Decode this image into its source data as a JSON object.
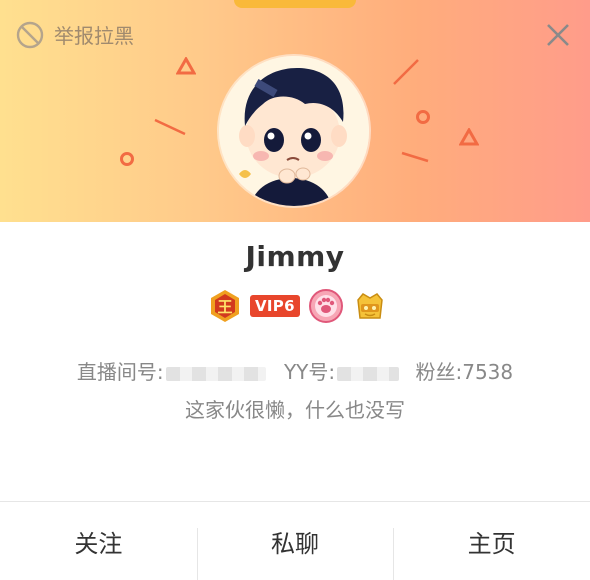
{
  "header": {
    "report_label": "举报拉黑",
    "colors": {
      "gradient_start": "#ffe08f",
      "gradient_end": "#ff9c8a",
      "decoration": "#f26b43"
    }
  },
  "profile": {
    "username": "Jimmy",
    "badges": [
      {
        "name": "king-badge",
        "text": "王"
      },
      {
        "name": "vip-badge",
        "text": "VIP6"
      },
      {
        "name": "paw-badge",
        "text": ""
      },
      {
        "name": "noble-badge",
        "text": ""
      }
    ],
    "live_id_label": "直播间号:",
    "yy_label": "YY号:",
    "fans_label": "粉丝:",
    "fans_count": "7538",
    "bio": "这家伙很懒，什么也没写"
  },
  "actions": {
    "follow": "关注",
    "message": "私聊",
    "homepage": "主页"
  }
}
